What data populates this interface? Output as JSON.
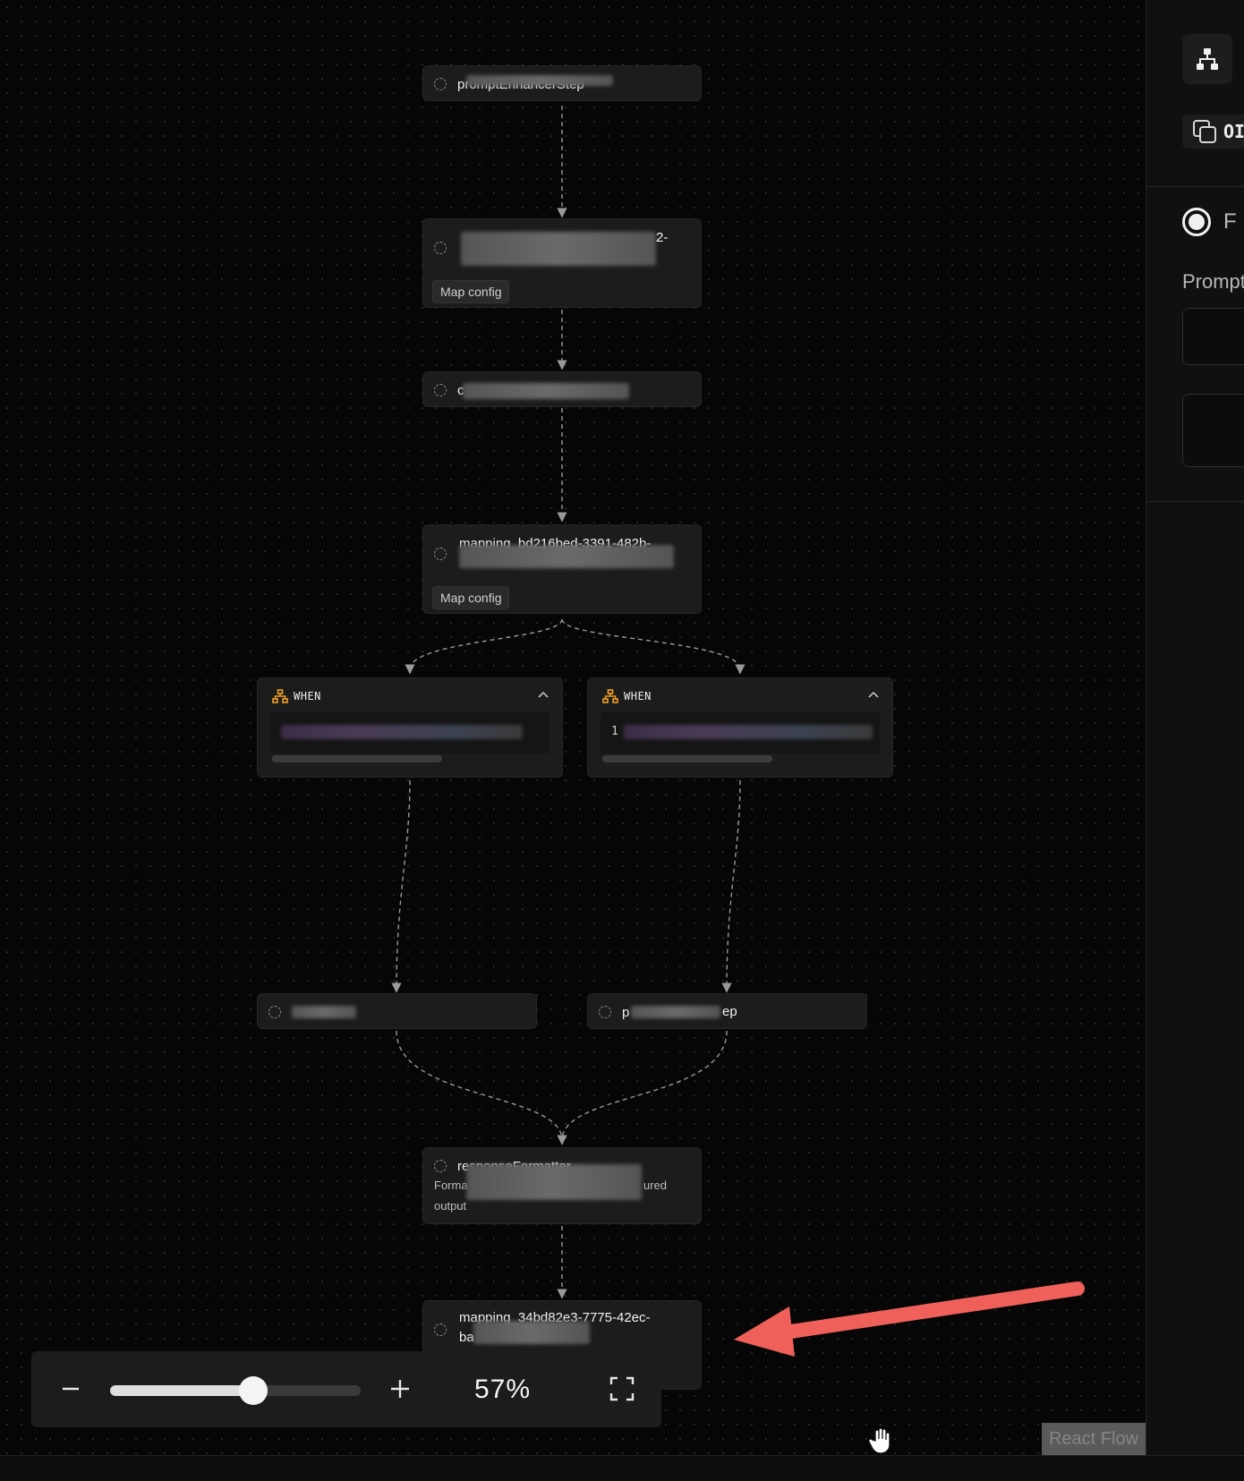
{
  "nodes": {
    "n1": {
      "title": "promptEnhancerStep"
    },
    "n2": {
      "title_suffix": "2-",
      "button": "Map config"
    },
    "n3": {
      "title_prefix": "c"
    },
    "n4": {
      "title": "mapping_bd216bed-3391-482b-",
      "button": "Map config"
    },
    "when_left": {
      "label": "WHEN"
    },
    "when_right": {
      "label": "WHEN",
      "code_line": "1"
    },
    "n5": {
      "title": ""
    },
    "n6": {
      "title_prefix": "p",
      "title_suffix": "ep"
    },
    "n7": {
      "title": "responseFormatter",
      "desc_prefix": "Forma",
      "desc_suffix": "ured",
      "desc_line2": "output"
    },
    "n8": {
      "title": "mapping_34bd82e3-7775-42ec-",
      "title_line2": "ba"
    }
  },
  "zoom": {
    "minus": "−",
    "plus": "+",
    "value": "57%",
    "level": 0.57
  },
  "attribution": "React Flow",
  "right_panel": {
    "copy_text": "OI",
    "radio_label": "F",
    "prompt_label": "Prompt"
  },
  "colors": {
    "accent_when": "#f0a020",
    "annotation_arrow": "#f0605a",
    "canvas_bg": "#060606",
    "node_bg": "#1c1c1c"
  }
}
